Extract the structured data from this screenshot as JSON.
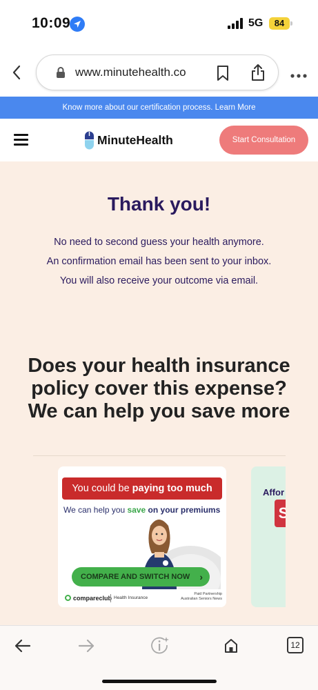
{
  "status_bar": {
    "time": "10:09",
    "network": "5G",
    "battery": "84",
    "icons": [
      "location-arrow-icon",
      "signal-bars-icon"
    ]
  },
  "browser": {
    "url": "www.minutehealth.co",
    "icons": [
      "back-chevron-icon",
      "lock-icon",
      "bookmark-icon",
      "share-icon",
      "more-icon"
    ]
  },
  "announcement": {
    "text": "Know more about our certification process. Learn More"
  },
  "site_header": {
    "logo_text": "MinuteHealth",
    "cta_label": "Start Consultation"
  },
  "main": {
    "title": "Thank you!",
    "messages": [
      "No need to second guess your health anymore.",
      "An confirmation email has been sent to your inbox.",
      "You will also receive your outcome via email."
    ],
    "question": "Does your health insurance policy cover this expense? We can help you save more"
  },
  "ads": [
    {
      "headline_prefix": "You could be ",
      "headline_bold": "paying too much",
      "sub_prefix": "We can help you ",
      "sub_green": "save",
      "sub_bold": " on your premiums",
      "button_label": "COMPARE AND SWITCH NOW",
      "brand": "compareclub",
      "brand_category": "Health Insurance",
      "partner_line1": "Paid Partnership",
      "partner_line2": "Australian Seniors News"
    },
    {
      "headline_partial": "Affor",
      "badge_partial": "S"
    }
  ],
  "bottom_toolbar": {
    "tab_count": "12",
    "icons": [
      "back-arrow-icon",
      "forward-arrow-icon",
      "info-sparkle-icon",
      "home-icon",
      "tabs-icon"
    ]
  },
  "colors": {
    "announcement": "#4a88ee",
    "cta": "#ee7b7b",
    "page_bg": "#fbeee4",
    "title": "#2a1a5e",
    "ad_red": "#c92b2b",
    "ad_green": "#43b04b"
  }
}
